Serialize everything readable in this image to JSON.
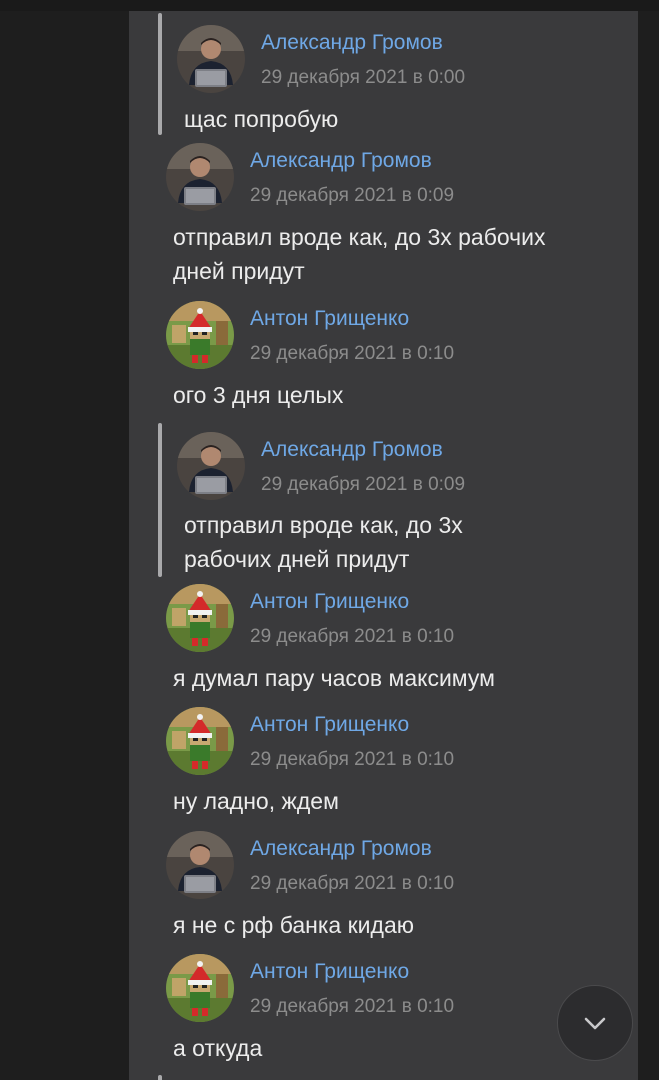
{
  "colors": {
    "background": "#1e1e1e",
    "panel": "#3a3a3c",
    "author_link": "#6fa8e6",
    "timestamp": "#8c8c8c",
    "message_text": "#ececec",
    "quote_bar": "#a9a9ab"
  },
  "messages": [
    {
      "kind": "quote",
      "author": "Александр Громов",
      "time": "29 декабря 2021 в 0:00",
      "text": "щас попробую",
      "avatar": "gromov-avatar-icon"
    },
    {
      "kind": "message",
      "author": "Александр Громов",
      "time": "29 декабря 2021 в 0:09",
      "text_line1": "отправил вроде как, до 3х рабочих",
      "text_line2": "дней придут",
      "avatar": "gromov-avatar-icon"
    },
    {
      "kind": "message",
      "author": "Антон Грищенко",
      "time": "29 декабря 2021 в 0:10",
      "text": "ого 3 дня целых",
      "avatar": "grischenko-avatar-icon"
    },
    {
      "kind": "quote",
      "author": "Александр Громов",
      "time": "29 декабря 2021 в 0:09",
      "text_line1": "отправил вроде как, до 3х",
      "text_line2": "рабочих дней придут",
      "avatar": "gromov-avatar-icon"
    },
    {
      "kind": "message",
      "author": "Антон Грищенко",
      "time": "29 декабря 2021 в 0:10",
      "text": "я думал пару часов максимум",
      "avatar": "grischenko-avatar-icon"
    },
    {
      "kind": "message",
      "author": "Антон Грищенко",
      "time": "29 декабря 2021 в 0:10",
      "text": "ну ладно, ждем",
      "avatar": "grischenko-avatar-icon"
    },
    {
      "kind": "message",
      "author": "Александр Громов",
      "time": "29 декабря 2021 в 0:10",
      "text": "я не с рф банка кидаю",
      "avatar": "gromov-avatar-icon"
    },
    {
      "kind": "message",
      "author": "Антон Грищенко",
      "time": "29 декабря 2021 в 0:10",
      "text": "а откуда",
      "avatar": "grischenko-avatar-icon"
    }
  ],
  "scroll_button": {
    "icon": "chevron-down-icon"
  }
}
